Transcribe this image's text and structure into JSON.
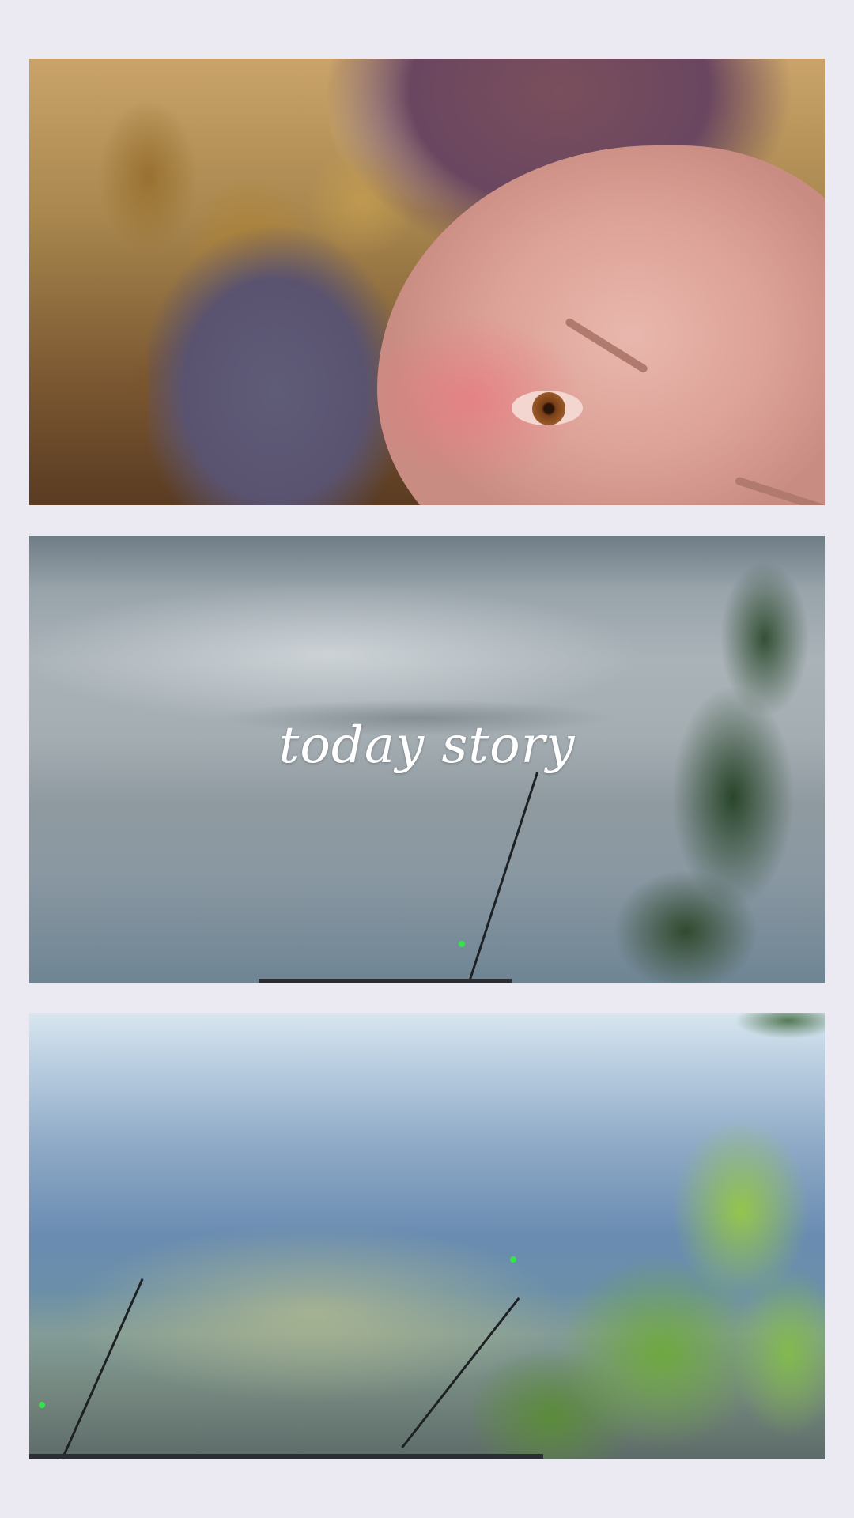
{
  "story": {
    "title": "today story"
  },
  "panels": [
    {
      "name": "sunset-selfie"
    },
    {
      "name": "foggy-lake-fishing-rod"
    },
    {
      "name": "clear-lake-fishing-rods"
    }
  ],
  "colors": {
    "background": "#ebeaf2",
    "title_text": "#ffffff",
    "rod_tip": "#35e44b"
  }
}
